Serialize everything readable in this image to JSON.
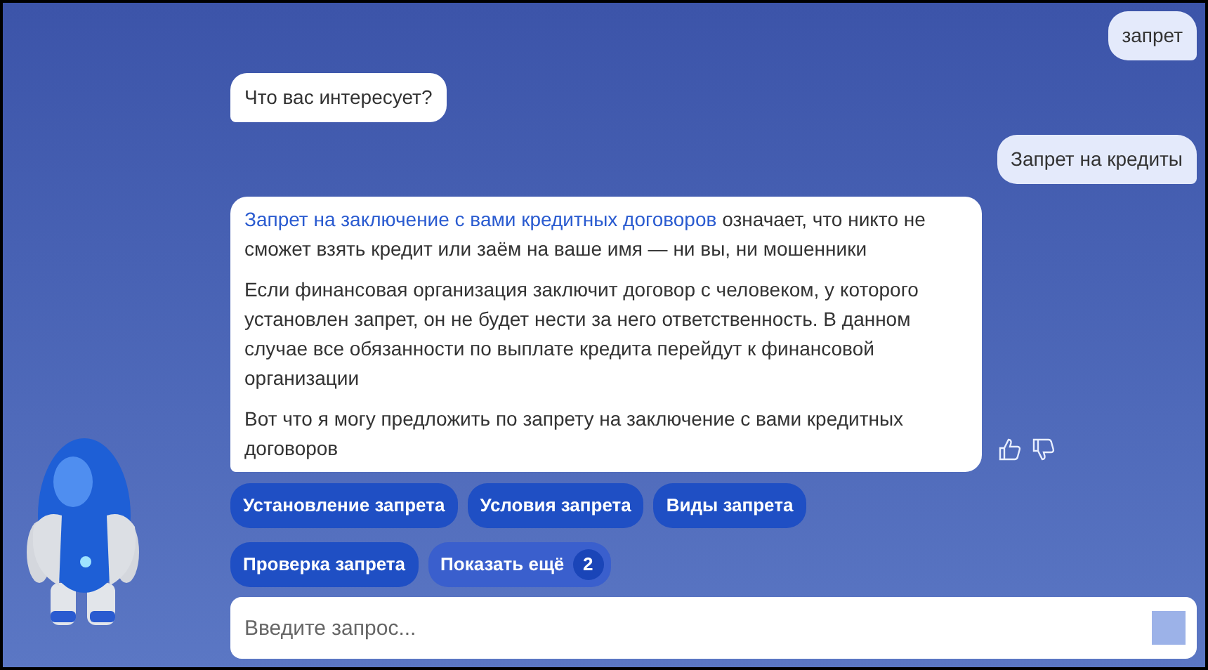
{
  "messages": [
    {
      "kind": "user",
      "text": "запрет"
    },
    {
      "kind": "bot",
      "paragraphs": [
        {
          "text": "Что вас интересует?"
        }
      ]
    },
    {
      "kind": "user",
      "text": "Запрет на кредиты"
    },
    {
      "kind": "bot",
      "feedback": true,
      "paragraphs": [
        {
          "link": "Запрет на заключение с вами кредитных договоров",
          "text": "означает, что никто не сможет взять кредит или заём на ваше имя — ни вы, ни мошенники"
        },
        {
          "text": "Если финансовая организация заключит договор с человеком, у которого установлен запрет, он не будет нести за него ответственность. В данном случае все обязанности по выплате кредита перейдут к финансовой организации"
        },
        {
          "text": "Вот что я могу предложить по запрету на заключение с вами кредитных договоров"
        }
      ]
    }
  ],
  "suggestions": [
    {
      "kind": "chip",
      "label": "Установление запрета"
    },
    {
      "kind": "chip",
      "label": "Условия запрета"
    },
    {
      "kind": "chip",
      "label": "Виды запрета"
    },
    {
      "kind": "chip",
      "label": "Проверка запрета"
    },
    {
      "kind": "more",
      "label": "Показать ещё",
      "count": "2"
    }
  ],
  "input": {
    "placeholder": "Введите запрос..."
  }
}
